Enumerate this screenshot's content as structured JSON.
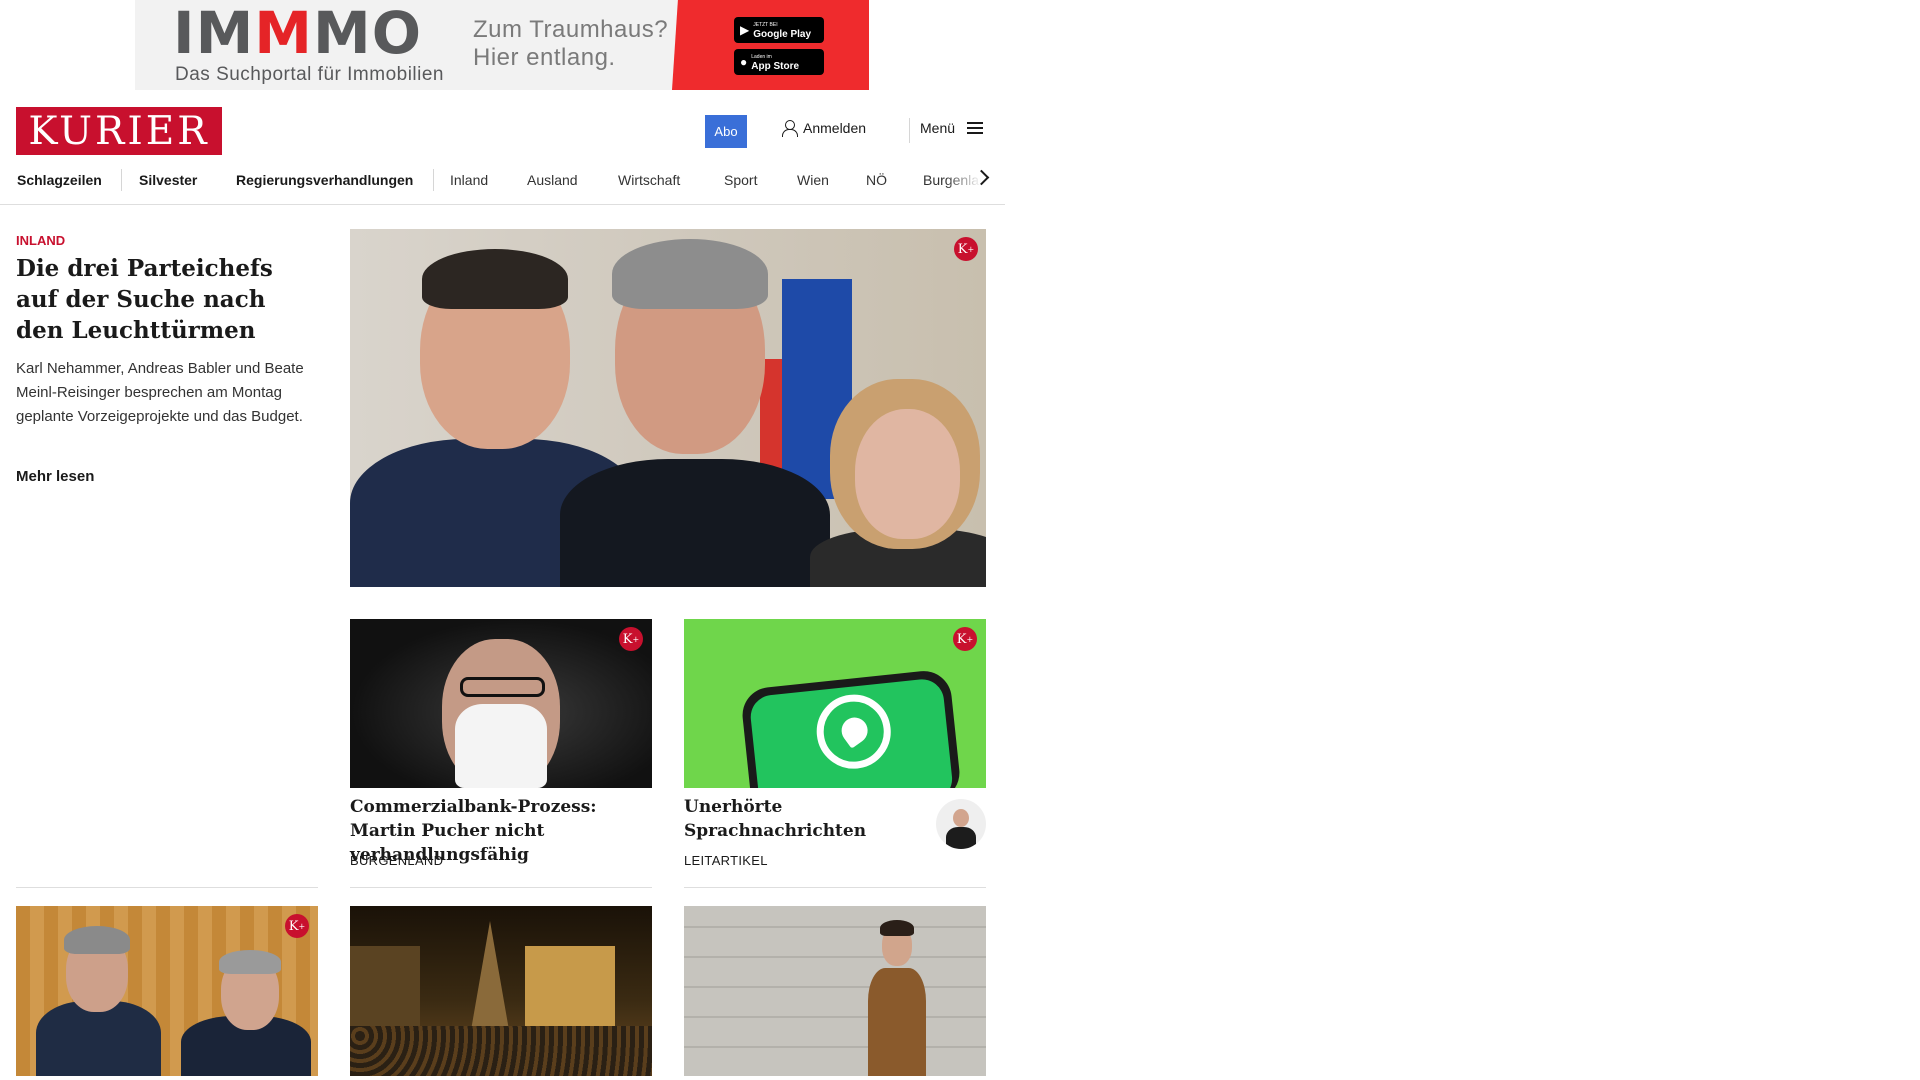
{
  "ad": {
    "logo_pre": "IM",
    "logo_mid": "M",
    "logo_post": "MO",
    "tagline": "Das Suchportal für Immobilien",
    "slogan_line1": "Zum Traumhaus?",
    "slogan_line2": "Hier entlang.",
    "google_play_small": "JETZT BEI",
    "google_play_label": "Google Play",
    "app_store_small": "Laden im",
    "app_store_label": "App Store"
  },
  "header": {
    "logo": "KURIER",
    "abo_label": "Abo",
    "login_label": "Anmelden",
    "menu_label": "Menü"
  },
  "nav": {
    "items": [
      "Schlagzeilen",
      "Silvester",
      "Regierungsverhandlungen",
      "Inland",
      "Ausland",
      "Wirtschaft",
      "Sport",
      "Wien",
      "NÖ",
      "Burgenland"
    ]
  },
  "lead": {
    "kicker": "INLAND",
    "title": "Die drei Parteichefs auf der Suche nach den Leuchttürmen",
    "teaser": "Karl Nehammer, Andreas Babler und Beate Meinl-Reisinger besprechen am Montag geplante Vorzeigeprojekte und das Budget.",
    "more_label": "Mehr lesen",
    "badge": "K"
  },
  "cards": [
    {
      "title": "Commerzialbank-Prozess: Martin Pucher nicht verhandlungsfähig",
      "category": "BURGENLAND",
      "badge": "K"
    },
    {
      "title": "Unerhörte Sprachnachrichten",
      "category": "LEITARTIKEL",
      "badge": "K"
    }
  ],
  "row3": {
    "badge": "K"
  },
  "colors": {
    "brand_red": "#c8102e",
    "abo_blue": "#3a6fd8"
  }
}
